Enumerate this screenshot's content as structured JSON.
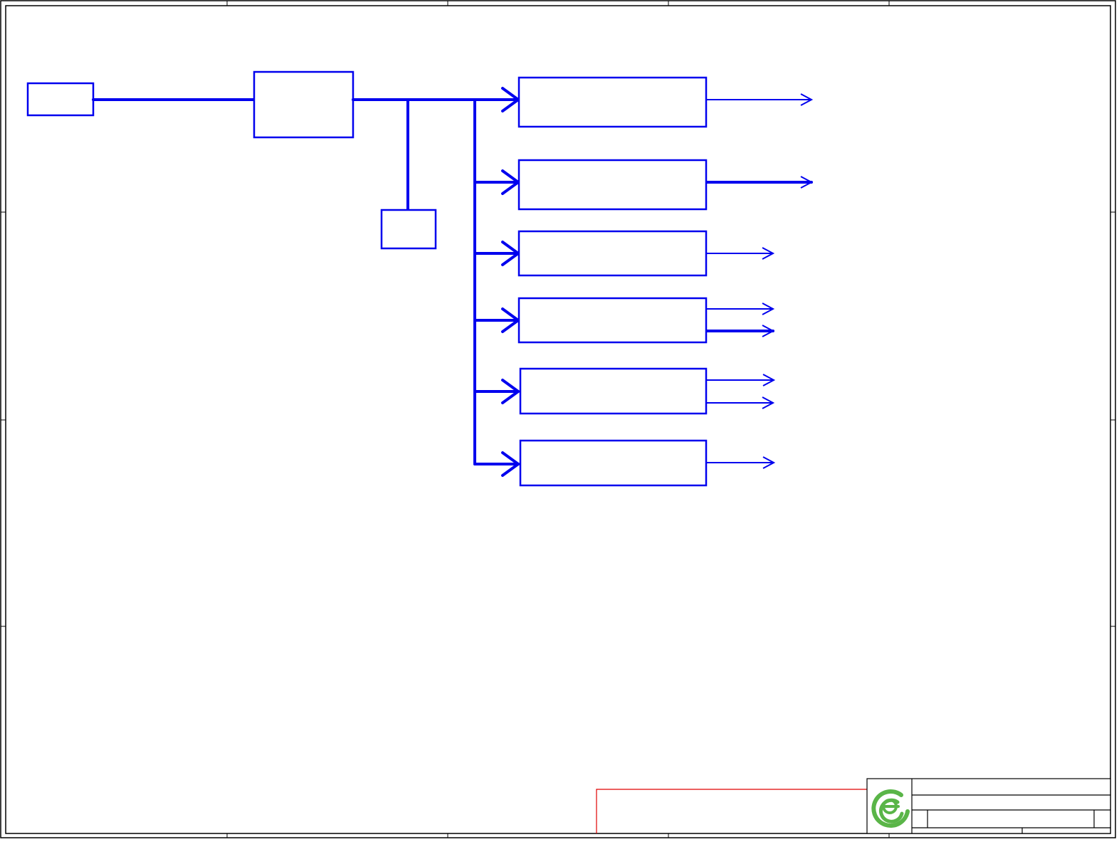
{
  "diagram": {
    "type": "schematic-block-diagram",
    "colors": {
      "wire": "#0000ee",
      "frame": "#000000",
      "note_box": "#e00000",
      "logo": "#5ab548"
    },
    "blocks": [
      {
        "id": "input-block",
        "label": ""
      },
      {
        "id": "main-regulator-block",
        "label": ""
      },
      {
        "id": "small-block",
        "label": ""
      },
      {
        "id": "output-block-1",
        "label": ""
      },
      {
        "id": "output-block-2",
        "label": ""
      },
      {
        "id": "output-block-3",
        "label": ""
      },
      {
        "id": "output-block-4",
        "label": ""
      },
      {
        "id": "output-block-5",
        "label": ""
      },
      {
        "id": "output-block-6",
        "label": ""
      }
    ],
    "title_block": {
      "logo_icon": "e-logo-icon",
      "title": "",
      "document": "",
      "sheet": ""
    }
  }
}
